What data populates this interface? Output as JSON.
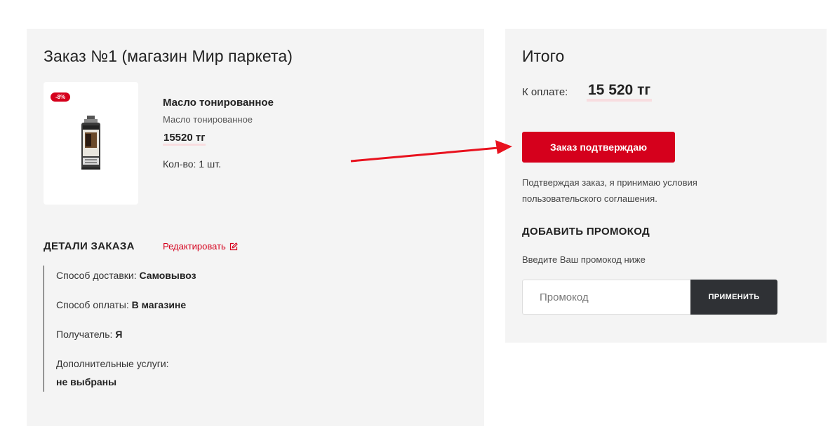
{
  "order": {
    "title": "Заказ №1 (магазин Мир паркета)",
    "item": {
      "discount_badge": "-8%",
      "name": "Масло тонированное",
      "subtitle": "Масло тонированное",
      "price": "15520 тг",
      "quantity": "Кол-во: 1 шт."
    },
    "details": {
      "title": "ДЕТАЛИ ЗАКАЗА",
      "edit_label": "Редактировать",
      "rows": [
        {
          "label": "Способ доставки: ",
          "value": "Самовывоз"
        },
        {
          "label": "Способ оплаты: ",
          "value": "В магазине"
        },
        {
          "label": "Получатель: ",
          "value": "Я"
        },
        {
          "label": "Дополнительные услуги:",
          "value": "не выбраны"
        }
      ]
    }
  },
  "summary": {
    "title": "Итого",
    "pay_label": "К оплате:",
    "pay_total": "15 520 тг",
    "confirm_label": "Заказ подтверждаю",
    "terms": "Подтверждая заказ, я принимаю условия пользовательского соглашения.",
    "promo": {
      "title": "ДОБАВИТЬ ПРОМОКОД",
      "hint": "Введите Ваш промокод ниже",
      "placeholder": "Промокод",
      "apply_label": "ПРИМЕНИТЬ"
    }
  },
  "colors": {
    "accent": "#d5001c",
    "panel": "#f4f4f4",
    "dark_button": "#2f3135"
  },
  "icons": {
    "edit": "edit-icon",
    "annotation": "arrow-annotation"
  }
}
